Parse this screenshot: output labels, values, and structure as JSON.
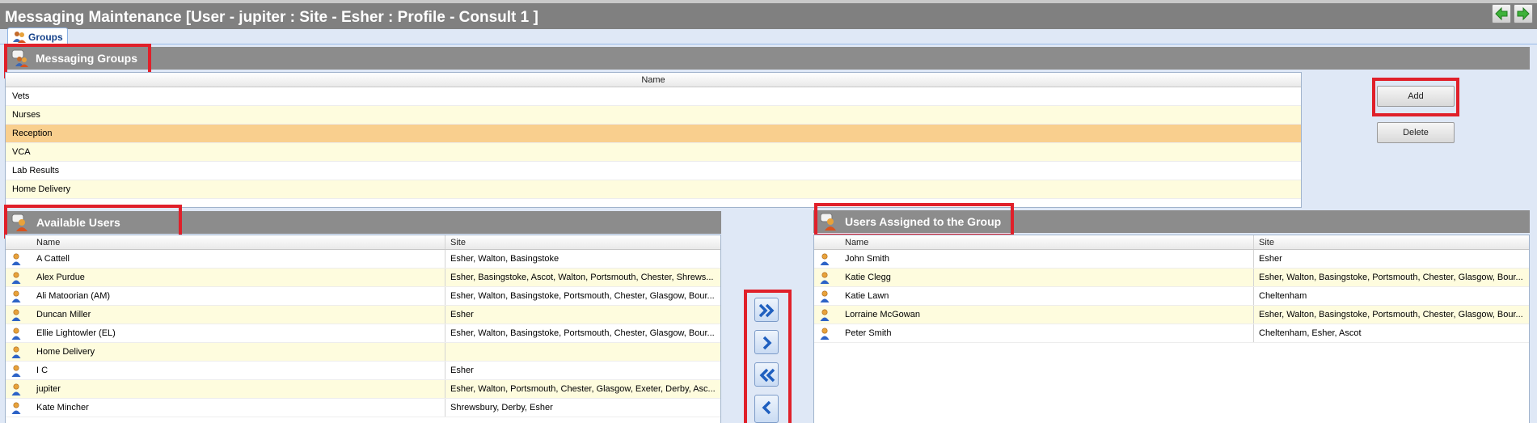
{
  "window": {
    "title": "Messaging Maintenance [User - jupiter : Site - Esher : Profile - Consult 1 ]"
  },
  "nav": {
    "back_icon": "arrow-left-icon",
    "forward_icon": "arrow-right-icon"
  },
  "tabs": [
    {
      "label": "Groups",
      "icon": "group-icon"
    }
  ],
  "messaging_groups": {
    "title": "Messaging Groups",
    "column_header": "Name",
    "rows": [
      "Vets",
      "Nurses",
      "Reception",
      "VCA",
      "Lab Results",
      "Home Delivery"
    ],
    "selected": "Reception"
  },
  "actions": {
    "add_label": "Add",
    "delete_label": "Delete"
  },
  "available_users": {
    "title": "Available Users",
    "columns": {
      "name": "Name",
      "site": "Site"
    },
    "rows": [
      {
        "name": "A Cattell",
        "site": "Esher, Walton, Basingstoke"
      },
      {
        "name": "Alex Purdue",
        "site": "Esher, Basingstoke, Ascot, Walton, Portsmouth, Chester, Shrews..."
      },
      {
        "name": "Ali Matoorian (AM)",
        "site": "Esher, Walton, Basingstoke, Portsmouth, Chester, Glasgow, Bour..."
      },
      {
        "name": "Duncan Miller",
        "site": "Esher"
      },
      {
        "name": "Ellie Lightowler (EL)",
        "site": "Esher, Walton, Basingstoke, Portsmouth, Chester, Glasgow, Bour..."
      },
      {
        "name": "Home Delivery",
        "site": ""
      },
      {
        "name": "I C",
        "site": "Esher"
      },
      {
        "name": "jupiter",
        "site": "Esher, Walton, Portsmouth, Chester, Glasgow, Exeter, Derby, Asc..."
      },
      {
        "name": "Kate Mincher",
        "site": "Shrewsbury, Derby, Esher"
      }
    ]
  },
  "transfer": {
    "icons": [
      "double-chevron-right-icon",
      "chevron-right-icon",
      "double-chevron-left-icon",
      "chevron-left-icon"
    ]
  },
  "assigned_users": {
    "title": "Users Assigned to the Group",
    "columns": {
      "name": "Name",
      "site": "Site"
    },
    "rows": [
      {
        "name": "John Smith",
        "site": "Esher"
      },
      {
        "name": "Katie Clegg",
        "site": "Esher, Walton, Basingstoke, Portsmouth, Chester, Glasgow, Bour..."
      },
      {
        "name": "Katie Lawn",
        "site": "Cheltenham"
      },
      {
        "name": "Lorraine McGowan",
        "site": "Esher, Walton, Basingstoke, Portsmouth, Chester, Glasgow, Bour..."
      },
      {
        "name": "Peter Smith",
        "site": "Cheltenham, Esher, Ascot"
      }
    ]
  },
  "colors": {
    "highlight": "#e0202a",
    "selected_row": "#f9cf8e",
    "alt_row": "#fefcde",
    "section_bar": "#8c8c8c"
  }
}
